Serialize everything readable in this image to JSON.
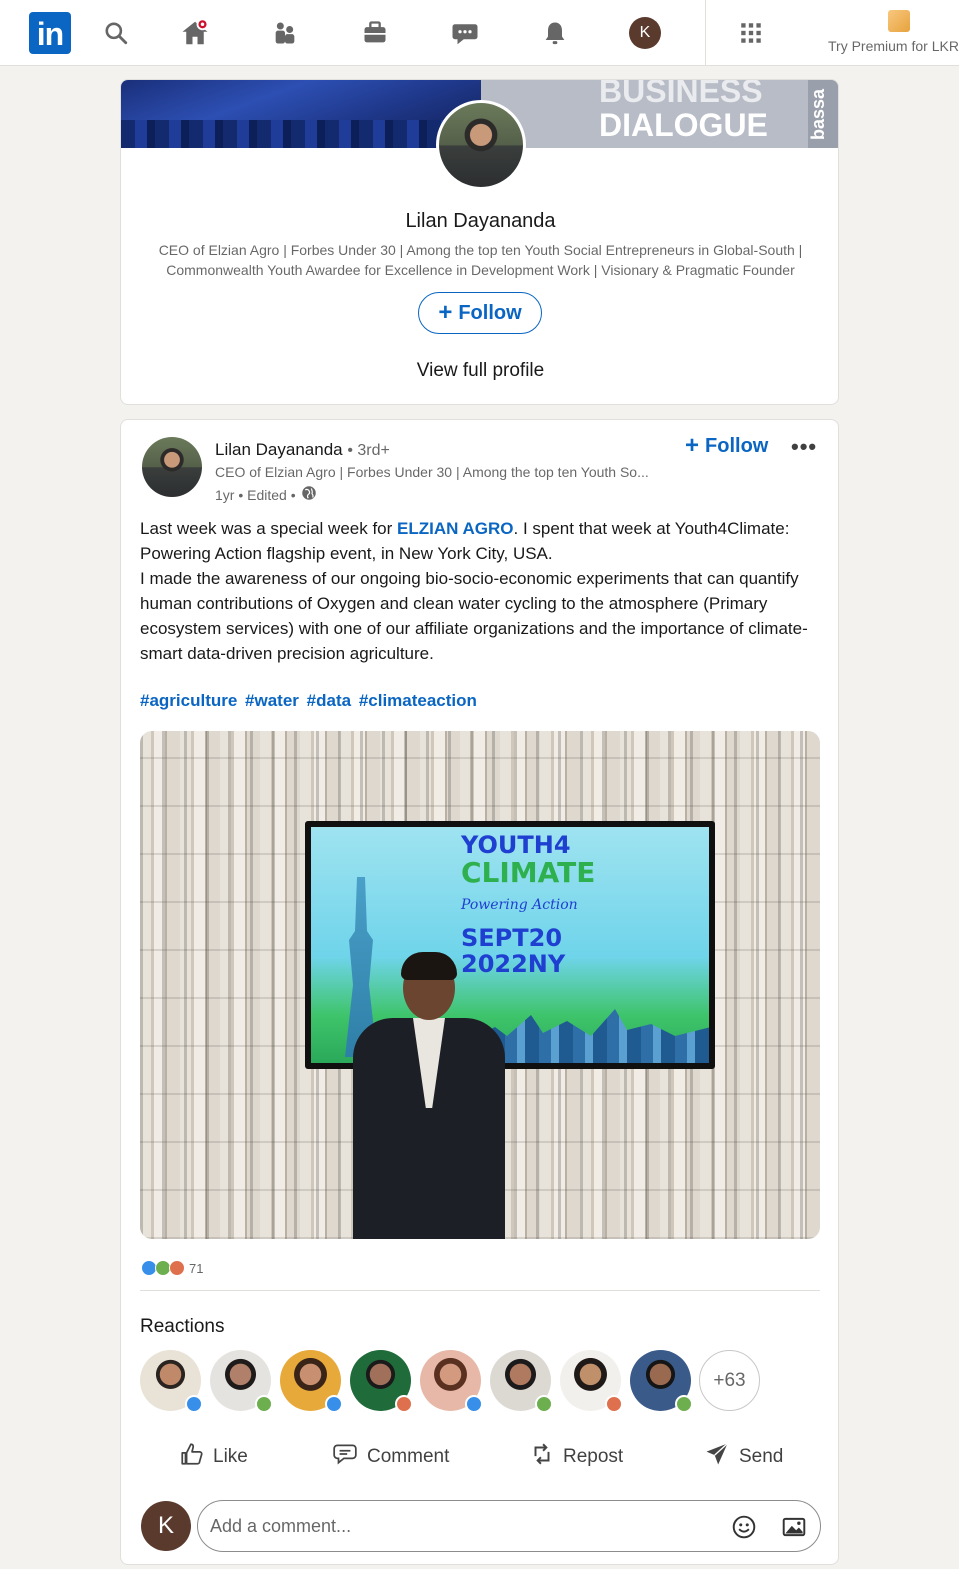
{
  "nav": {
    "logo_text": "in",
    "avatar_initial": "K",
    "premium_label": "Try Premium for LKR"
  },
  "profile_card": {
    "banner_text_line1": "BUSINESS",
    "banner_text_line2": "DIALOGUE",
    "banner_side_text": "bassa",
    "name": "Lilan Dayananda",
    "headline": "CEO of Elzian Agro | Forbes Under 30 | Among the top ten Youth Social Entrepreneurs in Global-South | Commonwealth Youth Awardee for Excellence in Development Work | Visionary & Pragmatic Founder",
    "follow_label": "Follow",
    "view_profile_label": "View full profile"
  },
  "post": {
    "author": "Lilan Dayananda",
    "degree": "• 3rd+",
    "headline": "CEO of Elzian Agro | Forbes Under 30 | Among the top ten Youth So...",
    "meta": "1yr • Edited •",
    "follow_label": "Follow",
    "more_label": "•••",
    "body_prefix": "Last week was a special week for ",
    "body_mention": "ELZIAN AGRO",
    "body_rest": ". I spent that week at Youth4Climate: Powering Action flagship event, in New York City, USA.",
    "body_para2": "I made the awareness of our ongoing bio-socio-economic experiments that can quantify human contributions of Oxygen and clean water cycling to the atmosphere (Primary ecosystem services) with one of our affiliate organizations and the importance of climate-smart data-driven precision agriculture.",
    "hashtags": [
      "#agriculture",
      "#water",
      "#data",
      "#climateaction"
    ],
    "image": {
      "tv_line1": "YOUTH4",
      "tv_line2": "CLIMATE",
      "tv_sub": "Powering Action",
      "tv_date1": "SEPT20",
      "tv_date2": "2022NY"
    },
    "reaction_count": "71",
    "reactions_title": "Reactions",
    "reactors_more": "+63",
    "actions": {
      "like": "Like",
      "comment": "Comment",
      "repost": "Repost",
      "send": "Send"
    },
    "comment_avatar_initial": "K",
    "comment_placeholder": "Add a comment..."
  },
  "colors": {
    "brand": "#0a66c2",
    "like_blue": "#378fe9",
    "support_green": "#6dae4f",
    "love_orange": "#df704d"
  }
}
